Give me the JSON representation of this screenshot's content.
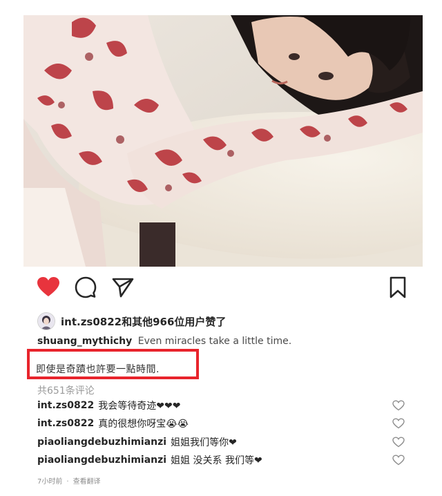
{
  "post": {
    "image_alt": "woman with bangs resting head on arms at a round white table, wearing white top with red floral pattern"
  },
  "actions": {
    "like_state": "liked",
    "like_color": "#e8343d"
  },
  "likes": {
    "text": "int.zs0822和其他966位用户赞了"
  },
  "caption": {
    "username": "shuang_mythichy",
    "text": "Even miracles take a little time."
  },
  "translation": {
    "text": "即使是奇蹟也許要一點時間."
  },
  "comments": {
    "count_label": "共651条评论",
    "items": [
      {
        "user": "int.zs0822",
        "text": "我会等待奇迹❤❤❤"
      },
      {
        "user": "int.zs0822",
        "text": "真的很想你呀宝😭😭"
      },
      {
        "user": "piaoliangdebuzhimianzi",
        "text": "姐姐我们等你❤"
      },
      {
        "user": "piaoliangdebuzhimianzi",
        "text": "姐姐 没关系 我们等❤"
      }
    ]
  },
  "meta": {
    "time": "7小时前",
    "dot": "·",
    "translate": "查看翻译"
  },
  "colors": {
    "highlight": "#e8242c",
    "heart": "#e8343d"
  }
}
